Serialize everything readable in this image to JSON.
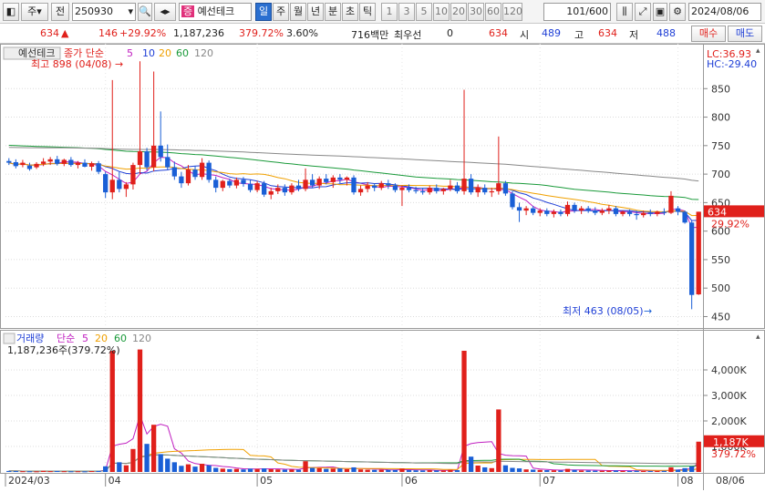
{
  "toolbar": {
    "period_mode": "주",
    "prev_label": "전",
    "code": "250930",
    "stock_name": "예선테크",
    "stock_badge": "증",
    "periods": [
      "일",
      "주",
      "월",
      "년",
      "분",
      "초",
      "틱"
    ],
    "active_period": "일",
    "intervals": [
      "1",
      "3",
      "5",
      "10",
      "20",
      "30",
      "60",
      "120"
    ],
    "count": "101/600",
    "date": "2024/08/06"
  },
  "quote": {
    "price": "634",
    "change": "146",
    "change_pct": "+29.92%",
    "volume": "1,187,236",
    "volume_pct": "379.72%",
    "turnover": "3.60%",
    "amount": "716백만",
    "best_bid_label": "최우선",
    "best_bid": "0",
    "ask": "634",
    "open_label": "시",
    "open": "489",
    "high_label": "고",
    "high": "634",
    "low_label": "저",
    "low": "488",
    "buy_label": "매수",
    "sell_label": "매도"
  },
  "price_pane": {
    "name_tag": "예선테크",
    "legend_title": "종가 단순",
    "ma_periods": [
      "5",
      "10",
      "20",
      "60",
      "120"
    ],
    "lc": "LC:36.93",
    "hc": "HC:-29.40",
    "high_marker": "최고 898 (04/08)",
    "low_marker": "최저 463 (08/05)",
    "last_price": "634",
    "last_pct": "29.92%"
  },
  "volume_pane": {
    "title": "거래량",
    "legend_title": "단순",
    "ma_periods": [
      "5",
      "20",
      "60",
      "120"
    ],
    "info": "1,187,236주(379.72%)",
    "last_vol": "1,187K",
    "last_pct": "379.72%"
  },
  "colors": {
    "up": "#e0201b",
    "down": "#1a5fd6",
    "ma5": "#c020c0",
    "ma10": "#1f3fd6",
    "ma20": "#f0a000",
    "ma60": "#1a9a3a",
    "ma120": "#888888"
  },
  "chart_data": {
    "type": "candlestick",
    "price_axis": [
      "850",
      "800",
      "750",
      "700",
      "650",
      "600",
      "550",
      "500",
      "450"
    ],
    "price_ylim": [
      430,
      900
    ],
    "volume_axis": [
      "4,000K",
      "3,000K",
      "2,000K",
      "1,000K"
    ],
    "volume_ylim": [
      0,
      5000
    ],
    "x_labels": [
      "2024/03",
      "04",
      "05",
      "06",
      "07",
      "08",
      "08/06"
    ],
    "candles": [
      {
        "o": 723,
        "h": 728,
        "l": 716,
        "c": 720,
        "v": 40
      },
      {
        "o": 721,
        "h": 726,
        "l": 710,
        "c": 714,
        "v": 35
      },
      {
        "o": 716,
        "h": 725,
        "l": 712,
        "c": 720,
        "v": 30
      },
      {
        "o": 715,
        "h": 720,
        "l": 706,
        "c": 709,
        "v": 28
      },
      {
        "o": 712,
        "h": 721,
        "l": 709,
        "c": 718,
        "v": 25
      },
      {
        "o": 718,
        "h": 728,
        "l": 714,
        "c": 722,
        "v": 45
      },
      {
        "o": 722,
        "h": 730,
        "l": 716,
        "c": 726,
        "v": 32
      },
      {
        "o": 726,
        "h": 732,
        "l": 715,
        "c": 718,
        "v": 38
      },
      {
        "o": 718,
        "h": 727,
        "l": 714,
        "c": 725,
        "v": 30
      },
      {
        "o": 725,
        "h": 730,
        "l": 713,
        "c": 716,
        "v": 26
      },
      {
        "o": 716,
        "h": 723,
        "l": 710,
        "c": 720,
        "v": 28
      },
      {
        "o": 720,
        "h": 726,
        "l": 712,
        "c": 713,
        "v": 24
      },
      {
        "o": 713,
        "h": 722,
        "l": 706,
        "c": 719,
        "v": 35
      },
      {
        "o": 719,
        "h": 723,
        "l": 700,
        "c": 704,
        "v": 40
      },
      {
        "o": 700,
        "h": 704,
        "l": 658,
        "c": 668,
        "v": 220
      },
      {
        "o": 668,
        "h": 865,
        "l": 656,
        "c": 690,
        "v": 4750
      },
      {
        "o": 690,
        "h": 704,
        "l": 668,
        "c": 674,
        "v": 380
      },
      {
        "o": 674,
        "h": 686,
        "l": 660,
        "c": 682,
        "v": 260
      },
      {
        "o": 682,
        "h": 720,
        "l": 673,
        "c": 716,
        "v": 900
      },
      {
        "o": 716,
        "h": 898,
        "l": 700,
        "c": 740,
        "v": 4800
      },
      {
        "o": 740,
        "h": 746,
        "l": 706,
        "c": 712,
        "v": 1100
      },
      {
        "o": 712,
        "h": 880,
        "l": 705,
        "c": 750,
        "v": 1850
      },
      {
        "o": 750,
        "h": 810,
        "l": 722,
        "c": 730,
        "v": 700
      },
      {
        "o": 730,
        "h": 752,
        "l": 708,
        "c": 712,
        "v": 520
      },
      {
        "o": 712,
        "h": 722,
        "l": 690,
        "c": 696,
        "v": 380
      },
      {
        "o": 696,
        "h": 704,
        "l": 676,
        "c": 684,
        "v": 240
      },
      {
        "o": 684,
        "h": 716,
        "l": 680,
        "c": 708,
        "v": 300
      },
      {
        "o": 708,
        "h": 714,
        "l": 690,
        "c": 695,
        "v": 210
      },
      {
        "o": 695,
        "h": 728,
        "l": 690,
        "c": 720,
        "v": 320
      },
      {
        "o": 720,
        "h": 724,
        "l": 685,
        "c": 690,
        "v": 260
      },
      {
        "o": 690,
        "h": 696,
        "l": 668,
        "c": 676,
        "v": 160
      },
      {
        "o": 676,
        "h": 690,
        "l": 670,
        "c": 688,
        "v": 130
      },
      {
        "o": 688,
        "h": 692,
        "l": 676,
        "c": 680,
        "v": 110
      },
      {
        "o": 680,
        "h": 694,
        "l": 675,
        "c": 690,
        "v": 120
      },
      {
        "o": 690,
        "h": 695,
        "l": 678,
        "c": 683,
        "v": 100
      },
      {
        "o": 683,
        "h": 690,
        "l": 668,
        "c": 672,
        "v": 130
      },
      {
        "o": 672,
        "h": 688,
        "l": 668,
        "c": 684,
        "v": 120
      },
      {
        "o": 684,
        "h": 688,
        "l": 660,
        "c": 664,
        "v": 140
      },
      {
        "o": 664,
        "h": 676,
        "l": 656,
        "c": 670,
        "v": 110
      },
      {
        "o": 670,
        "h": 682,
        "l": 665,
        "c": 676,
        "v": 100
      },
      {
        "o": 676,
        "h": 682,
        "l": 662,
        "c": 668,
        "v": 90
      },
      {
        "o": 668,
        "h": 684,
        "l": 664,
        "c": 680,
        "v": 95
      },
      {
        "o": 680,
        "h": 690,
        "l": 670,
        "c": 674,
        "v": 85
      },
      {
        "o": 674,
        "h": 710,
        "l": 670,
        "c": 690,
        "v": 420
      },
      {
        "o": 690,
        "h": 700,
        "l": 676,
        "c": 680,
        "v": 160
      },
      {
        "o": 680,
        "h": 696,
        "l": 674,
        "c": 692,
        "v": 150
      },
      {
        "o": 692,
        "h": 700,
        "l": 682,
        "c": 686,
        "v": 120
      },
      {
        "o": 686,
        "h": 698,
        "l": 676,
        "c": 694,
        "v": 130
      },
      {
        "o": 694,
        "h": 700,
        "l": 684,
        "c": 690,
        "v": 140
      },
      {
        "o": 690,
        "h": 696,
        "l": 680,
        "c": 694,
        "v": 110
      },
      {
        "o": 694,
        "h": 698,
        "l": 664,
        "c": 668,
        "v": 180
      },
      {
        "o": 668,
        "h": 680,
        "l": 662,
        "c": 674,
        "v": 100
      },
      {
        "o": 674,
        "h": 686,
        "l": 668,
        "c": 680,
        "v": 90
      },
      {
        "o": 680,
        "h": 684,
        "l": 670,
        "c": 676,
        "v": 80
      },
      {
        "o": 676,
        "h": 688,
        "l": 672,
        "c": 684,
        "v": 85
      },
      {
        "o": 684,
        "h": 690,
        "l": 674,
        "c": 680,
        "v": 80
      },
      {
        "o": 680,
        "h": 684,
        "l": 668,
        "c": 672,
        "v": 75
      },
      {
        "o": 672,
        "h": 680,
        "l": 644,
        "c": 676,
        "v": 130
      },
      {
        "o": 676,
        "h": 682,
        "l": 668,
        "c": 672,
        "v": 70
      },
      {
        "o": 672,
        "h": 678,
        "l": 666,
        "c": 670,
        "v": 65
      },
      {
        "o": 670,
        "h": 676,
        "l": 664,
        "c": 668,
        "v": 60
      },
      {
        "o": 668,
        "h": 680,
        "l": 664,
        "c": 676,
        "v": 70
      },
      {
        "o": 676,
        "h": 682,
        "l": 666,
        "c": 670,
        "v": 60
      },
      {
        "o": 670,
        "h": 676,
        "l": 664,
        "c": 674,
        "v": 55
      },
      {
        "o": 674,
        "h": 690,
        "l": 670,
        "c": 680,
        "v": 80
      },
      {
        "o": 680,
        "h": 686,
        "l": 666,
        "c": 670,
        "v": 70
      },
      {
        "o": 670,
        "h": 848,
        "l": 664,
        "c": 692,
        "v": 4750
      },
      {
        "o": 692,
        "h": 700,
        "l": 664,
        "c": 668,
        "v": 600
      },
      {
        "o": 668,
        "h": 682,
        "l": 660,
        "c": 676,
        "v": 250
      },
      {
        "o": 676,
        "h": 682,
        "l": 664,
        "c": 668,
        "v": 180
      },
      {
        "o": 668,
        "h": 676,
        "l": 660,
        "c": 670,
        "v": 150
      },
      {
        "o": 670,
        "h": 766,
        "l": 664,
        "c": 684,
        "v": 2450
      },
      {
        "o": 684,
        "h": 688,
        "l": 662,
        "c": 666,
        "v": 260
      },
      {
        "o": 666,
        "h": 670,
        "l": 638,
        "c": 642,
        "v": 160
      },
      {
        "o": 642,
        "h": 650,
        "l": 616,
        "c": 636,
        "v": 140
      },
      {
        "o": 636,
        "h": 644,
        "l": 628,
        "c": 640,
        "v": 100
      },
      {
        "o": 640,
        "h": 644,
        "l": 628,
        "c": 632,
        "v": 90
      },
      {
        "o": 632,
        "h": 640,
        "l": 626,
        "c": 636,
        "v": 80
      },
      {
        "o": 636,
        "h": 640,
        "l": 626,
        "c": 630,
        "v": 70
      },
      {
        "o": 630,
        "h": 638,
        "l": 624,
        "c": 634,
        "v": 65
      },
      {
        "o": 634,
        "h": 638,
        "l": 626,
        "c": 630,
        "v": 60
      },
      {
        "o": 630,
        "h": 652,
        "l": 626,
        "c": 646,
        "v": 120
      },
      {
        "o": 646,
        "h": 650,
        "l": 632,
        "c": 636,
        "v": 80
      },
      {
        "o": 636,
        "h": 644,
        "l": 630,
        "c": 640,
        "v": 60
      },
      {
        "o": 640,
        "h": 644,
        "l": 632,
        "c": 636,
        "v": 55
      },
      {
        "o": 636,
        "h": 642,
        "l": 628,
        "c": 632,
        "v": 50
      },
      {
        "o": 632,
        "h": 640,
        "l": 628,
        "c": 636,
        "v": 50
      },
      {
        "o": 636,
        "h": 646,
        "l": 630,
        "c": 640,
        "v": 55
      },
      {
        "o": 640,
        "h": 644,
        "l": 626,
        "c": 630,
        "v": 60
      },
      {
        "o": 630,
        "h": 636,
        "l": 626,
        "c": 634,
        "v": 45
      },
      {
        "o": 634,
        "h": 638,
        "l": 626,
        "c": 630,
        "v": 45
      },
      {
        "o": 630,
        "h": 636,
        "l": 620,
        "c": 628,
        "v": 50
      },
      {
        "o": 628,
        "h": 636,
        "l": 624,
        "c": 632,
        "v": 40
      },
      {
        "o": 632,
        "h": 638,
        "l": 626,
        "c": 630,
        "v": 40
      },
      {
        "o": 630,
        "h": 636,
        "l": 626,
        "c": 634,
        "v": 40
      },
      {
        "o": 634,
        "h": 640,
        "l": 628,
        "c": 632,
        "v": 45
      },
      {
        "o": 632,
        "h": 670,
        "l": 630,
        "c": 662,
        "v": 180
      },
      {
        "o": 640,
        "h": 644,
        "l": 628,
        "c": 634,
        "v": 90
      },
      {
        "o": 634,
        "h": 636,
        "l": 613,
        "c": 615,
        "v": 150
      },
      {
        "o": 615,
        "h": 618,
        "l": 463,
        "c": 488,
        "v": 220
      },
      {
        "o": 489,
        "h": 634,
        "l": 488,
        "c": 634,
        "v": 1187
      }
    ]
  }
}
